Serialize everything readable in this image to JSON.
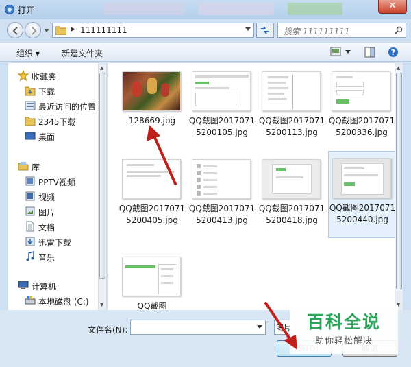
{
  "window": {
    "title": "打开",
    "close_glyph": "✕"
  },
  "address": {
    "path": "111111111",
    "search_placeholder": "搜索 111111111"
  },
  "toolbar": {
    "organize": "组织 ▾",
    "new_folder": "新建文件夹"
  },
  "nav": {
    "favorites_header": "收藏夹",
    "favorites": [
      "下载",
      "最近访问的位置",
      "2345下载",
      "桌面"
    ],
    "libraries_header": "库",
    "libraries": [
      "PPTV视频",
      "视频",
      "图片",
      "文档",
      "迅雷下载",
      "音乐"
    ],
    "computer_header": "计算机",
    "computer": [
      "本地磁盘 (C:)"
    ]
  },
  "files": [
    {
      "name": "128669.jpg",
      "kind": "photo"
    },
    {
      "name": "QQ截图20170715200105.jpg",
      "kind": "web-green"
    },
    {
      "name": "QQ截图20170715200113.jpg",
      "kind": "menu-list"
    },
    {
      "name": "QQ截图20170715200336.jpg",
      "kind": "form"
    },
    {
      "name": "QQ截图20170715200405.jpg",
      "kind": "blank-text"
    },
    {
      "name": "QQ截图20170715200413.jpg",
      "kind": "icon-list"
    },
    {
      "name": "QQ截图20170715200418.jpg",
      "kind": "dialog"
    },
    {
      "name": "QQ截图20170715200440.jpg",
      "kind": "form2",
      "selected": true
    },
    {
      "name": "QQ截图",
      "kind": "dropdown"
    }
  ],
  "bottom": {
    "filename_label": "文件名(N):",
    "filename_value": "",
    "type_partial": "图片",
    "open_button": "打开(O)",
    "cancel_button": "取消"
  },
  "watermark": {
    "title": "百科全说",
    "subtitle": "助你轻松解决"
  },
  "colors": {
    "accent": "#2aa55a",
    "arrow": "#c0201a",
    "selection": "#e4f0fb"
  }
}
